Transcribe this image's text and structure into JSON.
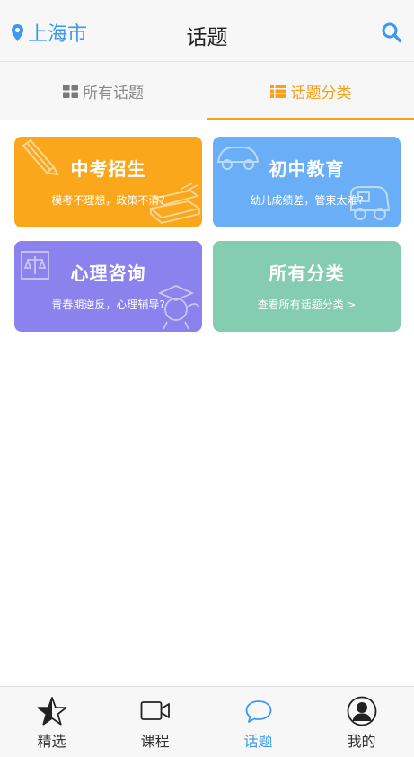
{
  "header": {
    "location_label": "上海市",
    "title": "话题",
    "search_icon": "search-icon"
  },
  "tabs": [
    {
      "label": "所有话题",
      "icon": "grid-icon",
      "active": false
    },
    {
      "label": "话题分类",
      "icon": "list-icon",
      "active": true
    }
  ],
  "categories": [
    {
      "title": "中考招生",
      "subtitle": "模考不理想，政策不清?",
      "color": "#faa71c"
    },
    {
      "title": "初中教育",
      "subtitle": "幼儿成绩差，管束太难?",
      "color": "#6aaef7"
    },
    {
      "title": "心理咨询",
      "subtitle": "青春期逆反，心理辅导?",
      "color": "#8c82ee"
    },
    {
      "title": "所有分类",
      "subtitle": "查看所有话题分类 >",
      "color": "#85cdb0"
    }
  ],
  "bottom_nav": [
    {
      "label": "精选",
      "icon": "star-icon",
      "active": false
    },
    {
      "label": "课程",
      "icon": "video-icon",
      "active": false
    },
    {
      "label": "话题",
      "icon": "chat-bubble-icon",
      "active": true
    },
    {
      "label": "我的",
      "icon": "user-icon",
      "active": false
    }
  ],
  "colors": {
    "accent_blue": "#3a99f0",
    "accent_orange": "#f5a11c"
  }
}
